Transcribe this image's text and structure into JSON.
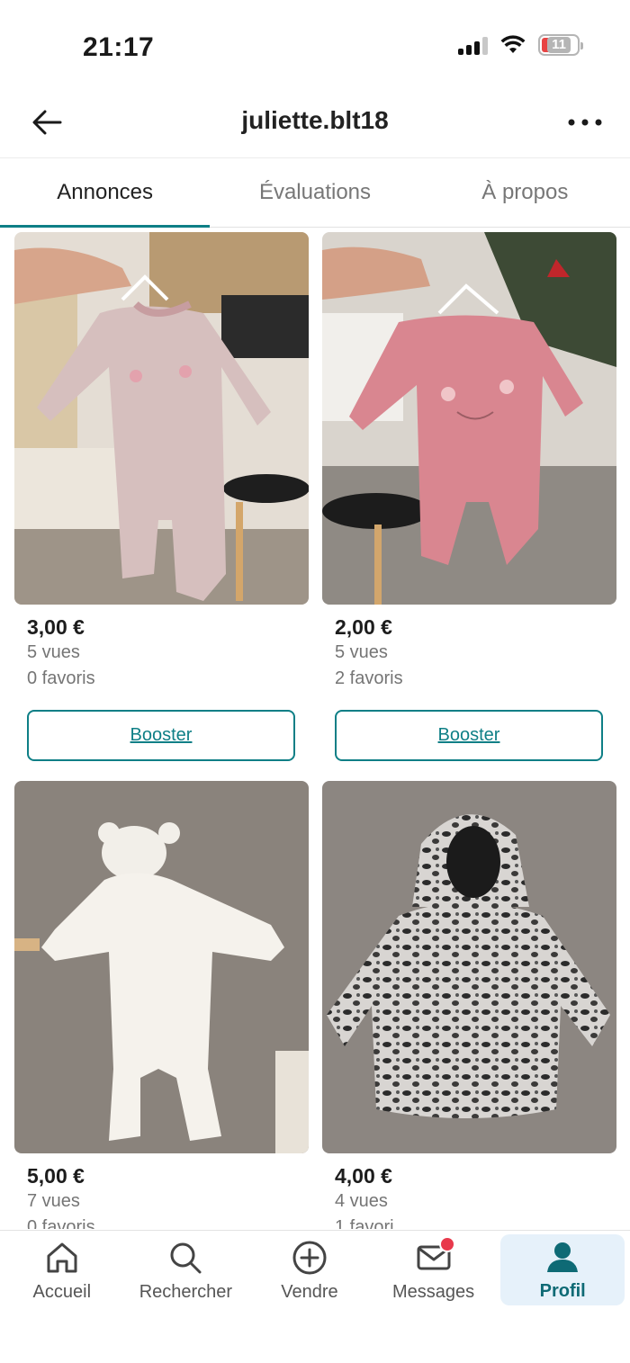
{
  "status_bar": {
    "time": "21:17",
    "battery_level": "11",
    "icons": [
      "cellular-signal-icon",
      "wifi-icon",
      "battery-icon"
    ]
  },
  "header": {
    "title": "juliette.blt18",
    "back_icon": "arrow-left-icon",
    "more_icon": "more-horizontal-icon"
  },
  "tabs": [
    {
      "label": "Annonces",
      "active": true
    },
    {
      "label": "Évaluations",
      "active": false
    },
    {
      "label": "À propos",
      "active": false
    }
  ],
  "listings": [
    {
      "price": "3,00 €",
      "views": "5 vues",
      "favorites": "0 favoris",
      "booster_label": "Booster",
      "photo": "pink baby sleepsuit on hanger"
    },
    {
      "price": "2,00 €",
      "views": "5 vues",
      "favorites": "2 favoris",
      "booster_label": "Booster",
      "photo": "rose baby sleepsuit with cat face"
    },
    {
      "price": "5,00 €",
      "views": "7 vues",
      "favorites": "0 favoris",
      "photo": "white fleece bear snowsuit"
    },
    {
      "price": "4,00 €",
      "views": "4 vues",
      "favorites": "1 favori",
      "photo": "leopard print hooded jacket"
    }
  ],
  "bottom_nav": [
    {
      "label": "Accueil",
      "icon": "home-icon",
      "active": false
    },
    {
      "label": "Rechercher",
      "icon": "search-icon",
      "active": false
    },
    {
      "label": "Vendre",
      "icon": "plus-circle-icon",
      "active": false
    },
    {
      "label": "Messages",
      "icon": "mail-icon",
      "active": false,
      "has_badge": true
    },
    {
      "label": "Profil",
      "icon": "profile-icon",
      "active": true
    }
  ],
  "colors": {
    "accent": "#0e7f86",
    "badge": "#e8394c",
    "active_nav_bg": "#e6f1fa"
  }
}
